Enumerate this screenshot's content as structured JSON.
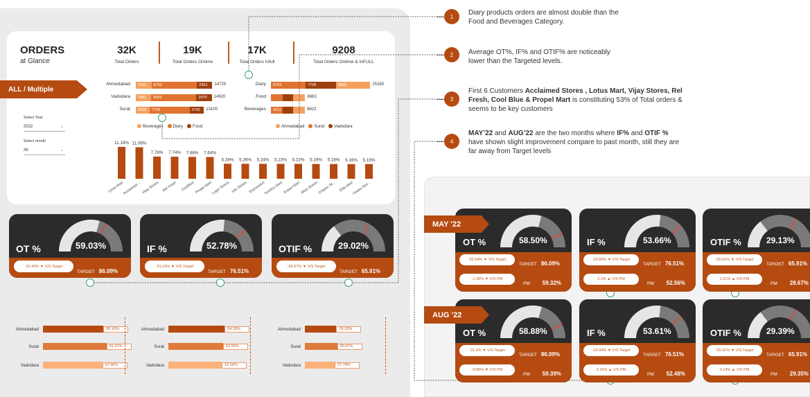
{
  "orders": {
    "title": "ORDERS",
    "subtitle": "at Glance",
    "kpis": [
      {
        "value": "32K",
        "label": "Total Orders"
      },
      {
        "value": "19K",
        "label": "Total Orders Ontime"
      },
      {
        "value": "17K",
        "label": "Total Orders Infull"
      },
      {
        "value": "9208",
        "label": "Total Orders Ontime & InFULL"
      }
    ]
  },
  "filter_tag": "ALL / Multiple",
  "year": {
    "label": "Select Year",
    "value": "2022"
  },
  "month": {
    "label": "Select month",
    "value": "All"
  },
  "colors": {
    "beverages": "#f4a15f",
    "diary": "#e0732f",
    "food": "#9e3f0e",
    "accent": "#b54b11",
    "dark": "#2b2b2b",
    "light": "#fbb27a"
  },
  "city_chart": {
    "rows": [
      {
        "city": "Ahmedabad",
        "segs": [
          "3011",
          "8763",
          "2951"
        ],
        "total": "14725"
      },
      {
        "city": "Vadodara",
        "segs": [
          "2981",
          "8669",
          "2970"
        ],
        "total": "14620"
      },
      {
        "city": "Surat",
        "segs": [
          "2630",
          "7728",
          "2742"
        ],
        "total": "13100"
      }
    ],
    "legend": [
      "Beverages",
      "Diary",
      "Food"
    ]
  },
  "cat_chart": {
    "rows": [
      {
        "cat": "Diary",
        "segs": [
          "8763",
          "7728",
          "8669"
        ],
        "total": "25160"
      },
      {
        "cat": "Food",
        "segs": [],
        "total": "8663"
      },
      {
        "cat": "Beverages",
        "segs": [
          "3011"
        ],
        "total": "8622"
      }
    ],
    "legend": [
      "Ahmedabad",
      "Surat",
      "Vadodara"
    ]
  },
  "chart_data": [
    {
      "type": "bar",
      "categories": [
        "Ahmedabad",
        "Vadodara",
        "Surat"
      ],
      "series": [
        {
          "name": "Beverages",
          "values": [
            3011,
            2981,
            2630
          ]
        },
        {
          "name": "Diary",
          "values": [
            8763,
            8669,
            7728
          ]
        },
        {
          "name": "Food",
          "values": [
            2951,
            2970,
            2742
          ]
        }
      ]
    },
    {
      "type": "bar",
      "categories": [
        "Diary",
        "Food",
        "Beverages"
      ],
      "series": [
        {
          "name": "Ahmedabad",
          "values": [
            8763,
            2951,
            3011
          ]
        },
        {
          "name": "Surat",
          "values": [
            7728,
            2742,
            2630
          ]
        },
        {
          "name": "Vadodara",
          "values": [
            8669,
            2970,
            2981
          ]
        }
      ],
      "totals": [
        25160,
        8663,
        8622
      ]
    },
    {
      "type": "bar",
      "categories": [
        "Lotus Mart",
        "Acclaimed ...",
        "Vijay Stores",
        "Rel Fresh",
        "Coolblue",
        "Propel Mart",
        "Logic Stores",
        "Info Stores",
        "Expression",
        "Sorefoz Mart",
        "Expert Mart",
        "Atlas Stores",
        "Chiptec St...",
        "Elite Mart",
        "Viveks Stor..."
      ],
      "values": [
        11.19,
        11.06,
        7.78,
        7.74,
        7.68,
        7.64,
        5.28,
        5.26,
        5.24,
        5.23,
        5.22,
        5.19,
        5.18,
        5.16,
        5.15
      ],
      "labels": [
        "11.19%",
        "11.06%",
        "7.78%",
        "7.74%",
        "7.68%",
        "7.64%",
        "5.28%",
        "5.26%",
        "5.24%",
        "5.23%",
        "5.22%",
        "5.19%",
        "5.18%",
        "5.16%",
        "5.15%"
      ]
    },
    {
      "type": "bar",
      "title": "OT %",
      "categories": [
        "Ahmedabad",
        "Surat",
        "Vadodara"
      ],
      "values": [
        58.16,
        61.21,
        57.06
      ],
      "labels": [
        "58.16%",
        "61.21%",
        "57.06%"
      ]
    },
    {
      "type": "bar",
      "title": "IF %",
      "categories": [
        "Ahmedabad",
        "Surat",
        "Vadodara"
      ],
      "values": [
        54.2,
        52.55,
        51.56
      ],
      "labels": [
        "54.20%",
        "52.55%",
        "51.56%"
      ]
    },
    {
      "type": "bar",
      "title": "OTIF %",
      "categories": [
        "Ahmedabad",
        "Surat",
        "Vadodara"
      ],
      "values": [
        29.33,
        30.07,
        27.78
      ],
      "labels": [
        "29.33%",
        "30.07%",
        "27.78%"
      ]
    }
  ],
  "gauges_main": [
    {
      "name": "OT %",
      "value": "59.03%",
      "frac": 0.5903,
      "target_frac": 0.6609,
      "vs": "-31.43% ▼ V/S Target",
      "tlabel": "TARGET",
      "tval": "86.09%"
    },
    {
      "name": "IF %",
      "value": "52.78%",
      "frac": 0.5278,
      "target_frac": 0.7651,
      "vs": "-31.03% ▼ V/S Target",
      "tlabel": "TARGET",
      "tval": "76.51%"
    },
    {
      "name": "OTIF %",
      "value": "29.02%",
      "frac": 0.2902,
      "target_frac": 0.6591,
      "vs": "-55.97% ▼ V/S Target",
      "tlabel": "TARGET",
      "tval": "65.91%"
    }
  ],
  "months": [
    {
      "tag": "MAY '22",
      "gauges": [
        {
          "name": "OT %",
          "value": "58.50%",
          "frac": 0.585,
          "target_frac": 0.8609,
          "vs": "-32.04% ▼ V/S Target",
          "tlabel": "TARGET",
          "tval": "86.09%",
          "pm": "-1.38% ▼ V/S PM",
          "pmlabel": "PM",
          "pmval": "59.32%"
        },
        {
          "name": "IF %",
          "value": "53.66%",
          "frac": 0.5366,
          "target_frac": 0.7651,
          "vs": "-29.86% ▼ V/S Target",
          "tlabel": "TARGET",
          "tval": "76.51%",
          "pm": "2.1% ▲ V/S PM",
          "pmlabel": "PM",
          "pmval": "52.56%"
        },
        {
          "name": "OTIF %",
          "value": "29.13%",
          "frac": 0.2913,
          "target_frac": 0.6591,
          "vs": "-55.81% ▼ V/S Target",
          "tlabel": "TARGET",
          "tval": "65.91%",
          "pm": "1.61% ▲ V/S PM",
          "pmlabel": "PM",
          "pmval": "28.67%"
        }
      ]
    },
    {
      "tag": "AUG '22",
      "gauges": [
        {
          "name": "OT %",
          "value": "58.88%",
          "frac": 0.5888,
          "target_frac": 0.8609,
          "vs": "-31.6% ▼ V/S Target",
          "tlabel": "TARGET",
          "tval": "86.09%",
          "pm": "-0.86% ▼ V/S PM",
          "pmlabel": "PM",
          "pmval": "59.39%"
        },
        {
          "name": "IF %",
          "value": "53.61%",
          "frac": 0.5361,
          "target_frac": 0.7651,
          "vs": "-29.94% ▼ V/S Target",
          "tlabel": "TARGET",
          "tval": "76.51%",
          "pm": "2.15% ▲ V/S PM",
          "pmlabel": "PM",
          "pmval": "52.48%"
        },
        {
          "name": "OTIF %",
          "value": "29.39%",
          "frac": 0.2939,
          "target_frac": 0.6591,
          "vs": "-55.41% ▼ V/S Target",
          "tlabel": "TARGET",
          "tval": "65.91%",
          "pm": "0.14% ▲ V/S PM",
          "pmlabel": "PM",
          "pmval": "29.35%"
        }
      ]
    }
  ],
  "notes": [
    {
      "num": "1",
      "html": "Diary products orders are almost double than the<br>Food and Beverages Category."
    },
    {
      "num": "2",
      "html": "Average OT%, IF% and OTIF% are noticeably<br>lower than the Targeted levels."
    },
    {
      "num": "3",
      "html": "First 6 Customers <b>Acclaimed Stores , Lotus Mart, Vijay Stores, Rel<br>Fresh, Cool Blue &amp; Propel Mart</b> is constituting 53%  of Total orders &amp;<br>seems to be key customers"
    },
    {
      "num": "4",
      "html": "<b>MAY’22</b> and <b>AUG’22</b> are the  two months where <b>IF%</b> and <b>OTIF %</b><br>have shown slight improvement compare to past month, still they are<br>far away from Target levels"
    }
  ]
}
